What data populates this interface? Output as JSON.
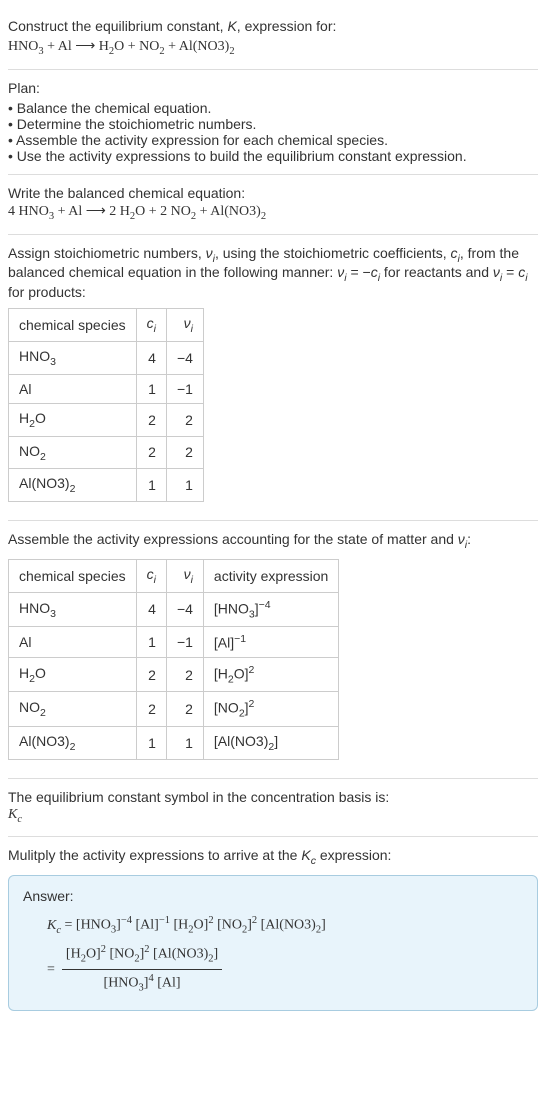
{
  "title_line1": "Construct the equilibrium constant, K, expression for:",
  "title_eq": "HNO₃ + Al ⟶ H₂O + NO₂ + Al(NO3)₂",
  "plan_heading": "Plan:",
  "plan_items": [
    "Balance the chemical equation.",
    "Determine the stoichiometric numbers.",
    "Assemble the activity expression for each chemical species.",
    "Use the activity expressions to build the equilibrium constant expression."
  ],
  "balanced_heading": "Write the balanced chemical equation:",
  "balanced_eq": "4 HNO₃ + Al ⟶ 2 H₂O + 2 NO₂ + Al(NO3)₂",
  "stoich_heading": "Assign stoichiometric numbers, νᵢ, using the stoichiometric coefficients, cᵢ, from the balanced chemical equation in the following manner: νᵢ = −cᵢ for reactants and νᵢ = cᵢ for products:",
  "table1": {
    "headers": [
      "chemical species",
      "cᵢ",
      "νᵢ"
    ],
    "rows": [
      {
        "species": "HNO₃",
        "c": "4",
        "v": "−4"
      },
      {
        "species": "Al",
        "c": "1",
        "v": "−1"
      },
      {
        "species": "H₂O",
        "c": "2",
        "v": "2"
      },
      {
        "species": "NO₂",
        "c": "2",
        "v": "2"
      },
      {
        "species": "Al(NO3)₂",
        "c": "1",
        "v": "1"
      }
    ]
  },
  "activity_heading": "Assemble the activity expressions accounting for the state of matter and νᵢ:",
  "table2": {
    "headers": [
      "chemical species",
      "cᵢ",
      "νᵢ",
      "activity expression"
    ],
    "rows": [
      {
        "species": "HNO₃",
        "c": "4",
        "v": "−4",
        "expr": "[HNO₃]⁻⁴"
      },
      {
        "species": "Al",
        "c": "1",
        "v": "−1",
        "expr": "[Al]⁻¹"
      },
      {
        "species": "H₂O",
        "c": "2",
        "v": "2",
        "expr": "[H₂O]²"
      },
      {
        "species": "NO₂",
        "c": "2",
        "v": "2",
        "expr": "[NO₂]²"
      },
      {
        "species": "Al(NO3)₂",
        "c": "1",
        "v": "1",
        "expr": "[Al(NO3)₂]"
      }
    ]
  },
  "symbol_heading": "The equilibrium constant symbol in the concentration basis is:",
  "symbol": "K_c",
  "multiply_heading": "Mulitply the activity expressions to arrive at the K_c expression:",
  "answer_label": "Answer:",
  "kc_line1": "K_c = [HNO₃]⁻⁴ [Al]⁻¹ [H₂O]² [NO₂]² [Al(NO3)₂]",
  "kc_frac_num": "[H₂O]² [NO₂]² [Al(NO3)₂]",
  "kc_frac_den": "[HNO₃]⁴ [Al]",
  "equals": "="
}
